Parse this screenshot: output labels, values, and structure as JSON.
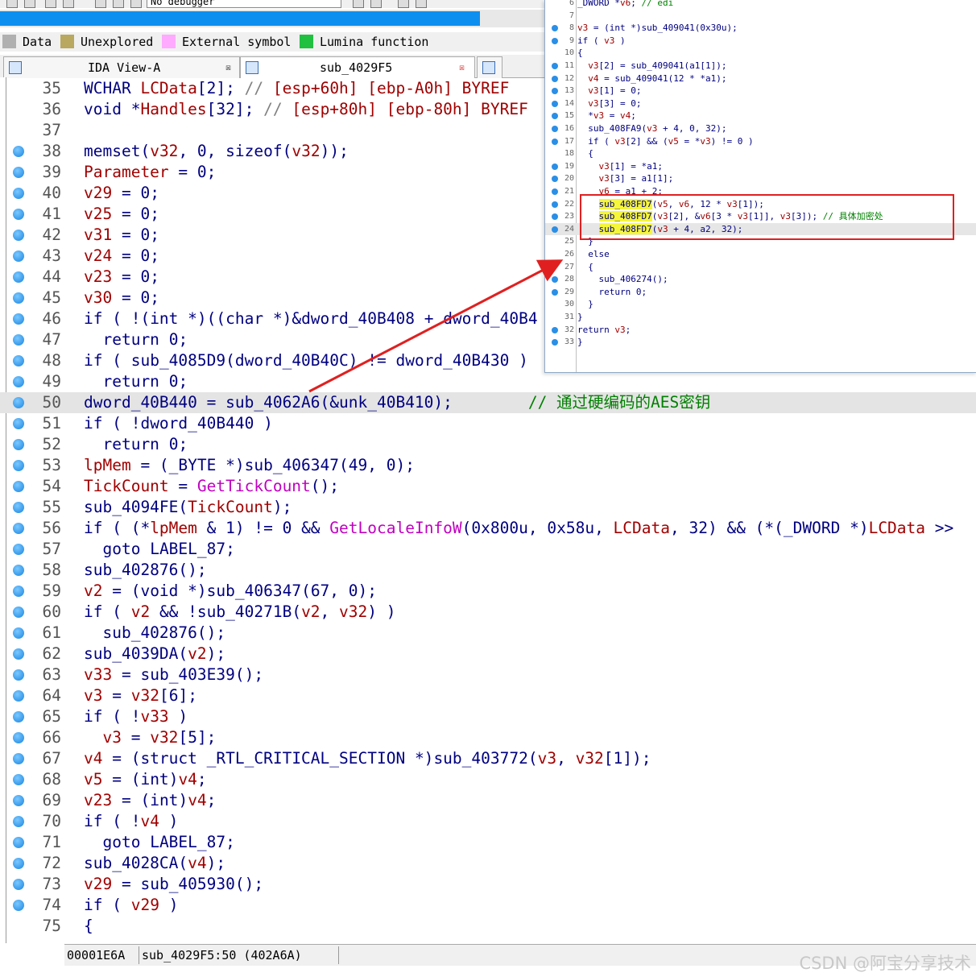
{
  "toolbar": {
    "debugger_select": "No debugger"
  },
  "legend": [
    {
      "label": "Data",
      "color": "#b0b0b0"
    },
    {
      "label": "Unexplored",
      "color": "#b8a860"
    },
    {
      "label": "External symbol",
      "color": "#ffaaff"
    },
    {
      "label": "Lumina function",
      "color": "#20c040"
    }
  ],
  "tabs": [
    {
      "label": "IDA View-A",
      "close": "☒"
    },
    {
      "label": "sub_4029F5",
      "close": "☒"
    }
  ],
  "code_lines": [
    {
      "num": "35",
      "dot": false,
      "text": "WCHAR LCData[2]; // [esp+60h] [ebp-A0h] BYREF"
    },
    {
      "num": "36",
      "dot": false,
      "text": "void *Handles[32]; // [esp+80h] [ebp-80h] BYREF"
    },
    {
      "num": "37",
      "dot": false,
      "text": ""
    },
    {
      "num": "38",
      "dot": true,
      "text": "memset(v32, 0, sizeof(v32));"
    },
    {
      "num": "39",
      "dot": true,
      "text": "Parameter = 0;"
    },
    {
      "num": "40",
      "dot": true,
      "text": "v29 = 0;"
    },
    {
      "num": "41",
      "dot": true,
      "text": "v25 = 0;"
    },
    {
      "num": "42",
      "dot": true,
      "text": "v31 = 0;"
    },
    {
      "num": "43",
      "dot": true,
      "text": "v24 = 0;"
    },
    {
      "num": "44",
      "dot": true,
      "text": "v23 = 0;"
    },
    {
      "num": "45",
      "dot": true,
      "text": "v30 = 0;"
    },
    {
      "num": "46",
      "dot": true,
      "text": "if ( !(int *)((char *)&dword_40B408 + dword_40B4"
    },
    {
      "num": "47",
      "dot": true,
      "text": "  return 0;"
    },
    {
      "num": "48",
      "dot": true,
      "text": "if ( sub_4085D9(dword_40B40C) != dword_40B430 )"
    },
    {
      "num": "49",
      "dot": true,
      "text": "  return 0;"
    },
    {
      "num": "50",
      "dot": true,
      "text": "dword_40B440 = sub_4062A6(&unk_40B410);        // 通过硬编码的AES密钥"
    },
    {
      "num": "51",
      "dot": true,
      "text": "if ( !dword_40B440 )"
    },
    {
      "num": "52",
      "dot": true,
      "text": "  return 0;"
    },
    {
      "num": "53",
      "dot": true,
      "text": "lpMem = (_BYTE *)sub_406347(49, 0);"
    },
    {
      "num": "54",
      "dot": true,
      "text": "TickCount = GetTickCount();"
    },
    {
      "num": "55",
      "dot": true,
      "text": "sub_4094FE(TickCount);"
    },
    {
      "num": "56",
      "dot": true,
      "text": "if ( (*lpMem & 1) != 0 && GetLocaleInfoW(0x800u, 0x58u, LCData, 32) && (*(_DWORD *)LCData >>"
    },
    {
      "num": "57",
      "dot": true,
      "text": "  goto LABEL_87;"
    },
    {
      "num": "58",
      "dot": true,
      "text": "sub_402876();"
    },
    {
      "num": "59",
      "dot": true,
      "text": "v2 = (void *)sub_406347(67, 0);"
    },
    {
      "num": "60",
      "dot": true,
      "text": "if ( v2 && !sub_40271B(v2, v32) )"
    },
    {
      "num": "61",
      "dot": true,
      "text": "  sub_402876();"
    },
    {
      "num": "62",
      "dot": true,
      "text": "sub_4039DA(v2);"
    },
    {
      "num": "63",
      "dot": true,
      "text": "v33 = sub_403E39();"
    },
    {
      "num": "64",
      "dot": true,
      "text": "v3 = v32[6];"
    },
    {
      "num": "65",
      "dot": true,
      "text": "if ( !v33 )"
    },
    {
      "num": "66",
      "dot": true,
      "text": "  v3 = v32[5];"
    },
    {
      "num": "67",
      "dot": true,
      "text": "v4 = (struct _RTL_CRITICAL_SECTION *)sub_403772(v3, v32[1]);"
    },
    {
      "num": "68",
      "dot": true,
      "text": "v5 = (int)v4;"
    },
    {
      "num": "69",
      "dot": true,
      "text": "v23 = (int)v4;"
    },
    {
      "num": "70",
      "dot": true,
      "text": "if ( !v4 )"
    },
    {
      "num": "71",
      "dot": true,
      "text": "  goto LABEL_87;"
    },
    {
      "num": "72",
      "dot": true,
      "text": "sub_4028CA(v4);"
    },
    {
      "num": "73",
      "dot": true,
      "text": "v29 = sub_405930();"
    },
    {
      "num": "74",
      "dot": true,
      "text": "if ( v29 )"
    },
    {
      "num": "75",
      "dot": false,
      "text": "{"
    }
  ],
  "overlay_lines": [
    {
      "num": "6",
      "dot": false,
      "text": "_DWORD *v6; // edi"
    },
    {
      "num": "7",
      "dot": false,
      "text": ""
    },
    {
      "num": "8",
      "dot": true,
      "text": "v3 = (int *)sub_409041(0x30u);"
    },
    {
      "num": "9",
      "dot": true,
      "text": "if ( v3 )"
    },
    {
      "num": "10",
      "dot": false,
      "text": "{"
    },
    {
      "num": "11",
      "dot": true,
      "text": "  v3[2] = sub_409041(a1[1]);"
    },
    {
      "num": "12",
      "dot": true,
      "text": "  v4 = sub_409041(12 * *a1);"
    },
    {
      "num": "13",
      "dot": true,
      "text": "  v3[1] = 0;"
    },
    {
      "num": "14",
      "dot": true,
      "text": "  v3[3] = 0;"
    },
    {
      "num": "15",
      "dot": true,
      "text": "  *v3 = v4;"
    },
    {
      "num": "16",
      "dot": true,
      "text": "  sub_408FA9(v3 + 4, 0, 32);"
    },
    {
      "num": "17",
      "dot": true,
      "text": "  if ( v3[2] && (v5 = *v3) != 0 )"
    },
    {
      "num": "18",
      "dot": false,
      "text": "  {"
    },
    {
      "num": "19",
      "dot": true,
      "text": "    v3[1] = *a1;"
    },
    {
      "num": "20",
      "dot": true,
      "text": "    v3[3] = a1[1];"
    },
    {
      "num": "21",
      "dot": true,
      "text": "    v6 = a1 + 2;"
    },
    {
      "num": "22",
      "dot": true,
      "fn": "sub_408FD7",
      "text": "(v5, v6, 12 * v3[1]);"
    },
    {
      "num": "23",
      "dot": true,
      "fn": "sub_408FD7",
      "text": "(v3[2], &v6[3 * v3[1]], v3[3]); // 具体加密处"
    },
    {
      "num": "24",
      "dot": true,
      "fn": "sub_408FD7",
      "text": "(v3 + 4, a2, 32);"
    },
    {
      "num": "25",
      "dot": false,
      "text": "  }"
    },
    {
      "num": "26",
      "dot": false,
      "text": "  else"
    },
    {
      "num": "27",
      "dot": false,
      "text": "  {"
    },
    {
      "num": "28",
      "dot": true,
      "text": "    sub_406274();"
    },
    {
      "num": "29",
      "dot": true,
      "text": "    return 0;"
    },
    {
      "num": "30",
      "dot": false,
      "text": "  }"
    },
    {
      "num": "31",
      "dot": false,
      "text": "}"
    },
    {
      "num": "32",
      "dot": true,
      "text": "return v3;"
    },
    {
      "num": "33",
      "dot": true,
      "text": "}"
    }
  ],
  "status": {
    "address": "00001E6A",
    "location": "sub_4029F5:50 (402A6A)"
  },
  "watermark": "CSDN @阿宝分享技术",
  "colors": {
    "accent": "#0d8ff0",
    "annotation_red": "#e02020",
    "highlight_yellow": "#f5f53a"
  }
}
